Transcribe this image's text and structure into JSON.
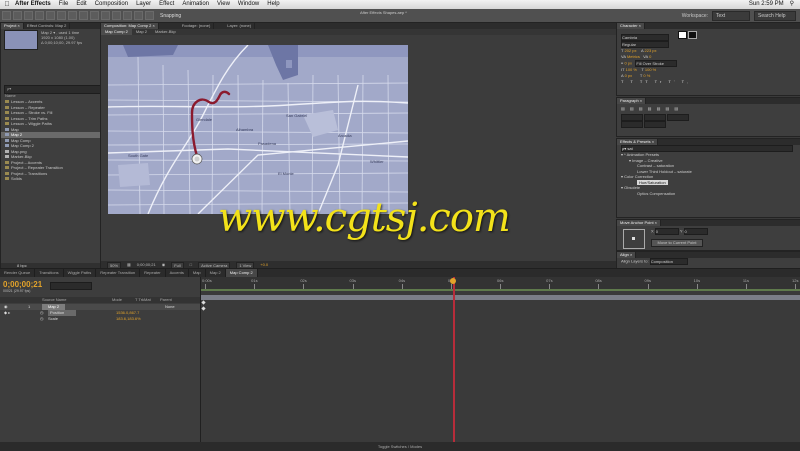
{
  "menubar": {
    "app": "After Effects",
    "items": [
      "File",
      "Edit",
      "Composition",
      "Layer",
      "Effect",
      "Animation",
      "View",
      "Window",
      "Help"
    ],
    "title": "After Effects Shapes.aep *",
    "clock": "Sun 2:59 PM"
  },
  "toolbar": {
    "snapping": "Snapping",
    "workspace_label": "Workspace:",
    "workspace": "Text",
    "search": "Search Help"
  },
  "project": {
    "tabs": [
      "Project ×",
      "Effect Controls: Map 2"
    ],
    "item_name": "Map 2 ▾ , used 1 time",
    "item_size": "1920 x 1080 (1.00)",
    "item_duration": "Δ 0;00;10;00, 29.97 fps",
    "search_placeholder": "ρ▾",
    "column": "Name",
    "items": [
      {
        "name": "Lesson – Accents",
        "type": "folder"
      },
      {
        "name": "Lesson – Repeater",
        "type": "folder"
      },
      {
        "name": "Lesson – Stroke vs. Fill",
        "type": "folder"
      },
      {
        "name": "Lesson – Trim Paths",
        "type": "folder"
      },
      {
        "name": "Lesson – Wiggle Paths",
        "type": "folder"
      },
      {
        "name": "Map",
        "type": "comp"
      },
      {
        "name": "Map 2",
        "type": "comp",
        "selected": true
      },
      {
        "name": "Map Comp",
        "type": "comp"
      },
      {
        "name": "Map Comp 2",
        "type": "comp"
      },
      {
        "name": "Map.png",
        "type": "file"
      },
      {
        "name": "Marker-Bkp",
        "type": "file"
      },
      {
        "name": "Project – Accents",
        "type": "folder"
      },
      {
        "name": "Project – Repeater Transition",
        "type": "folder"
      },
      {
        "name": "Project – Transitions",
        "type": "folder"
      },
      {
        "name": "Solids",
        "type": "folder"
      }
    ],
    "bpc": "8 bpc"
  },
  "comp": {
    "tabs": [
      "Composition: Map Comp 2 ×",
      "Footage: (none)",
      "Layer: (none)"
    ],
    "subtabs": [
      "Map Comp 2",
      "Map 2",
      "Marker-Bkp"
    ],
    "zoom": "50%",
    "time": "0;00;00;21",
    "resolution": "Full",
    "camera": "Active Camera",
    "views": "1 View",
    "exposure": "+0.0",
    "map_labels": [
      "Glendale",
      "San Gabriel",
      "South Gate",
      "Pasadena",
      "Alhambra",
      "Arcadia",
      "El Monte",
      "Whittier"
    ]
  },
  "character": {
    "title": "Character ×",
    "font": "Cambria",
    "style": "Regular",
    "size": "202 px",
    "leading": "223 px",
    "kerning": "Metrics",
    "tracking": "0",
    "stroke": "0 px",
    "stroke_type": "Fill Over Stroke",
    "vscale": "100 %",
    "hscale": "100 %",
    "baseline": "0 px",
    "tsume": "0 %"
  },
  "paragraph": {
    "title": "Paragraph ×"
  },
  "effects": {
    "title": "Effects & Presets ×",
    "search": "ρ▾ sat",
    "rows": [
      {
        "text": "▾ * Animation Presets",
        "indent": 0
      },
      {
        "text": "▾ Image – Creative",
        "indent": 1
      },
      {
        "text": "Contrast – saturation",
        "indent": 2
      },
      {
        "text": "Lower Third Holdout – saturate",
        "indent": 2
      },
      {
        "text": "▾ Color Correction",
        "indent": 0
      },
      {
        "text": "Hue/Saturation",
        "indent": 2,
        "highlight": true
      },
      {
        "text": "▾ Obsolete",
        "indent": 0
      },
      {
        "text": "Optics Compensation",
        "indent": 2
      }
    ]
  },
  "anchor": {
    "title": "Move Anchor Point ×",
    "x": "0",
    "y": "0",
    "button": "Move to Current Point"
  },
  "align": {
    "title": "Align ×",
    "label": "Align Layers to:",
    "value": "Composition",
    "distribute": "Distribute Layers:"
  },
  "timeline": {
    "tabs": [
      "Render Queue",
      "Transitions",
      "Wiggle Paths",
      "Repeater Transition",
      "Repeater",
      "Accents",
      "Map",
      "Map 2",
      "Map Comp 2"
    ],
    "timecode": "0;00;00;21",
    "timecode_sub": "00021 (29.97 fps)",
    "columns": [
      "Source Name",
      "Mode",
      "T TrkMat",
      "Parent"
    ],
    "layer": {
      "num": "1",
      "name": "Map 2",
      "parent": "None"
    },
    "props": [
      {
        "name": "Position",
        "value": "1536.0,867.7"
      },
      {
        "name": "Scale",
        "value": "183.6,183.6%"
      }
    ],
    "ruler": [
      "0:00s",
      "01s",
      "02s",
      "03s",
      "04s",
      "05s",
      "06s",
      "07s",
      "08s",
      "09s",
      "10s",
      "11s",
      "12s"
    ],
    "footer": "Toggle Switches / Modes"
  },
  "watermark": "www.cgtsj.com",
  "colors": {
    "map_bg": "#a2a9c9",
    "map_road": "#dfe3f2",
    "map_water": "#6d76a5",
    "route": "#8b1a2e",
    "timecode": "#e3a32a",
    "playhead": "#b72c3a",
    "watermark": "#f3e21a"
  }
}
